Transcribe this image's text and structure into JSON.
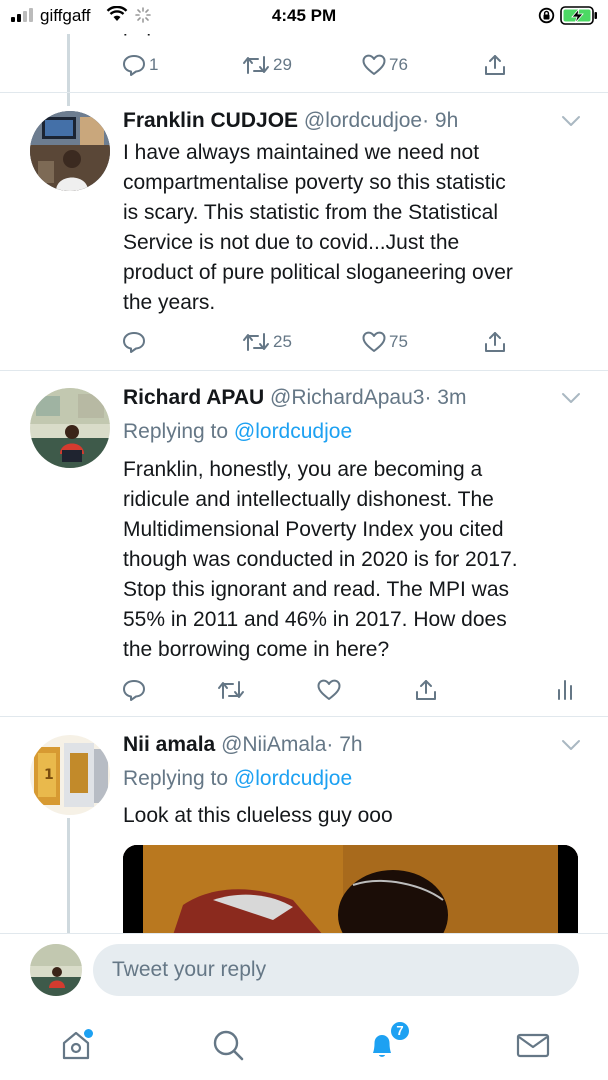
{
  "status_bar": {
    "carrier": "giffgaff",
    "time": "4:45 PM"
  },
  "previous_tweet": {
    "text_fragment": "population.",
    "replies": "1",
    "retweets": "29",
    "likes": "76"
  },
  "tweets": [
    {
      "name": "Franklin CUDJOE",
      "handle": "@lordcudjoe",
      "time": "· 9h",
      "text_lines": [
        "I have always maintained we need not",
        "compartmentalise poverty so this statistic",
        "is scary. This statistic from the Statistical",
        "Service is not due to covid...Just the",
        "product of pure political sloganeering over",
        "the years."
      ],
      "retweets": "25",
      "likes": "75"
    },
    {
      "name": "Richard APAU",
      "handle": "@RichardApau3",
      "time": "· 3m",
      "replying_label": "Replying to",
      "replying_to": "@lordcudjoe",
      "text_lines": [
        "Franklin, honestly, you are becoming a",
        "ridicule and intellectually dishonest. The",
        "Multidimensional Poverty Index you cited",
        "though was conducted in 2020 is for 2017.",
        "Stop this ignorant and read. The MPI was",
        "55% in 2011 and 46% in 2017. How does",
        "the borrowing come in here?"
      ]
    },
    {
      "name": "Nii amala",
      "handle": "@NiiAmala",
      "time": "· 7h",
      "replying_label": "Replying to",
      "replying_to": "@lordcudjoe",
      "text_lines": [
        "Look at this clueless guy ooo"
      ]
    }
  ],
  "composer": {
    "placeholder": "Tweet your reply"
  },
  "tabbar": {
    "notifications_badge": "7"
  },
  "colors": {
    "accent": "#1da1f2",
    "secondary_text": "#657786",
    "divider": "#e1e8ed",
    "battery_green": "#4cd964"
  }
}
